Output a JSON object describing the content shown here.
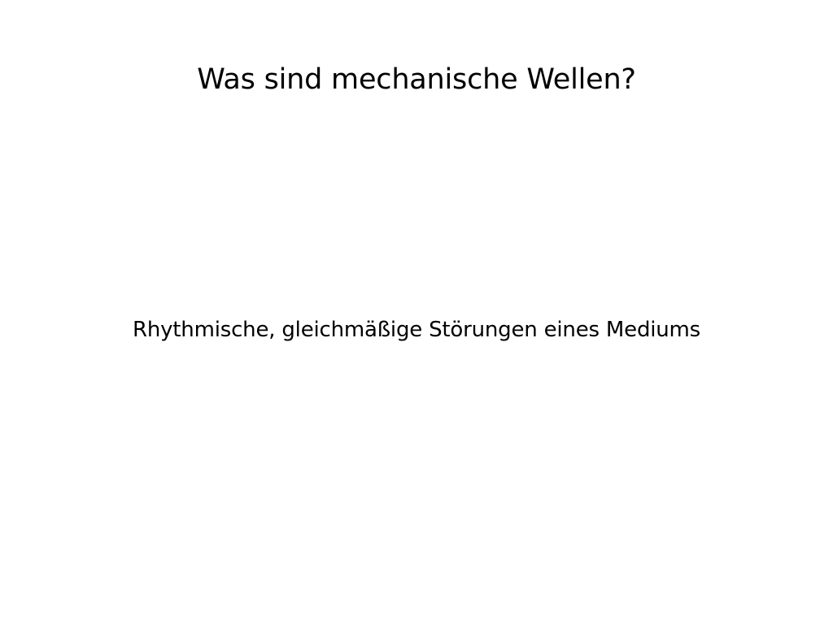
{
  "slide": {
    "title": "Was sind mechanische Wellen?",
    "body": "Rhythmische, gleichmäßige Störungen eines Mediums"
  },
  "colors": {
    "background": "#ffffff",
    "text": "#000000"
  }
}
